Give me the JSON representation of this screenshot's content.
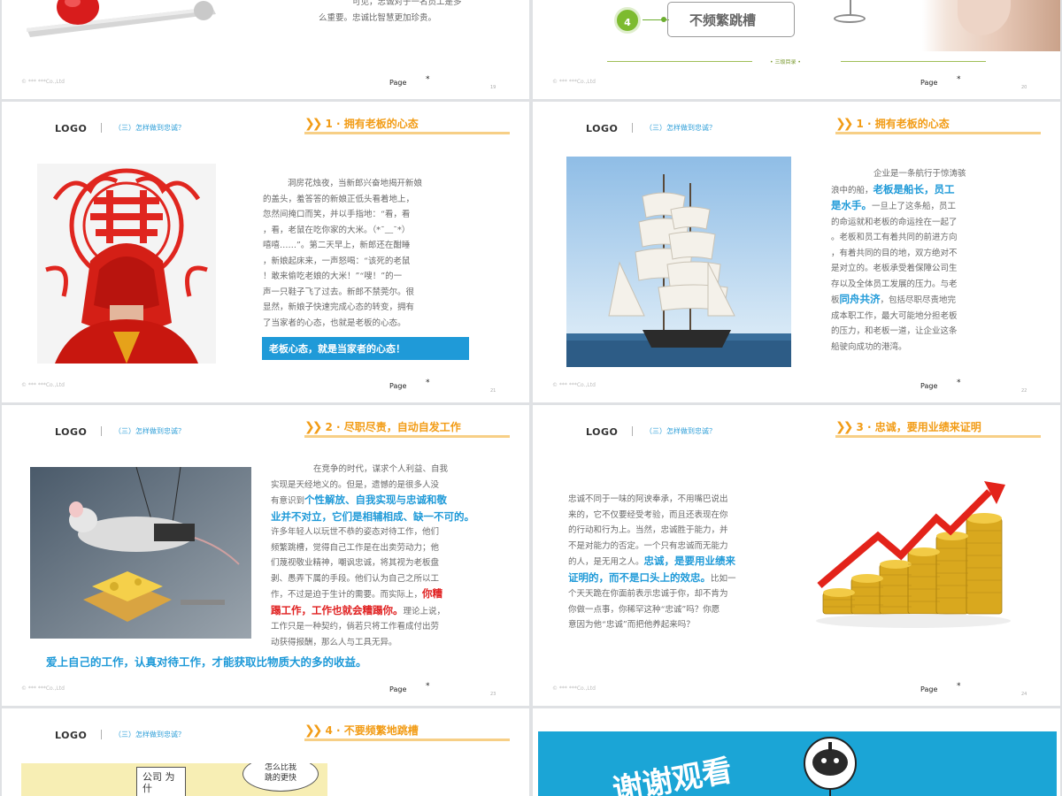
{
  "common": {
    "logo": "LOGO",
    "section": "（三）怎样做到忠诚？",
    "footer_company": "© *** ***Co.,Ltd",
    "footer_page": "Page",
    "footer_star": "*"
  },
  "slide1": {
    "text_line1": "可见，忠诚对于一名员工是多",
    "text_line2": "么重要。忠诚比智慧更加珍贵。",
    "slide_no": "19"
  },
  "slide2": {
    "badge_number": "4",
    "item_label": "不频繁跳槽",
    "bottom_label": "三级目录",
    "slide_no": "20"
  },
  "slide3": {
    "title": "1 · 拥有老板的心态",
    "paragraph": [
      "洞房花烛夜，当新郎兴奋地揭开新娘",
      "的盖头，羞答答的新娘正低头看着地上，",
      "忽然间掩口而笑，并以手指地：“看，看",
      "，看，老鼠在吃你家的大米。（*ˉ﹏ˉ*）",
      "嘻嘻……”。第二天早上，新郎还在酣睡",
      "，新娘起床来，一声怒喝：“该死的老鼠",
      "！敢来偷吃老娘的大米！”“嗖！”的一",
      "声一只鞋子飞了过去。新郎不禁莞尔。很",
      "显然，新娘子快速完成心态的转变，拥有",
      "了当家者的心态，也就是老板的心态。"
    ],
    "callout": "老板心态，就是当家者的心态！",
    "slide_no": "21"
  },
  "slide4": {
    "title": "1 · 拥有老板的心态",
    "p1": "企业是一条航行于惊涛骇",
    "p2": "浪中的船，",
    "hl1": "老板是船长，员工",
    "hl2": "是水手。",
    "p3": "一旦上了这条船，员工",
    "lines": [
      "的命运就和老板的命运拴在一起了",
      "。老板和员工有着共同的前进方向",
      "，有着共同的目的地，双方绝对不",
      "是对立的。老板承受着保障公司生",
      "存以及全体员工发展的压力。与老"
    ],
    "p4": "板",
    "hl3": "同舟共济",
    "p5": "，包括尽职尽责地完",
    "lines2": [
      "成本职工作，最大可能地分担老板",
      "的压力，和老板一道，让企业这条",
      "船驶向成功的港湾。"
    ],
    "slide_no": "22"
  },
  "slide5": {
    "title": "2 · 尽职尽责，自动自发工作",
    "l1": "在竞争的时代，谋求个人利益、自我",
    "l2": "实现是天经地义的。但是，遗憾的是很多人没",
    "l3a": "有意识到",
    "l3b": "个性解放、自我实现与忠诚和敬",
    "l4": "业并不对立，它们是相辅相成、缺一不可的。",
    "lines": [
      "许多年轻人以玩世不恭的姿态对待工作，他们",
      "频繁跳槽，觉得自己工作是在出卖劳动力；他",
      "们蔑视敬业精神，嘲讽忠诚，将其视为老板盘",
      "剥、愚弄下属的手段。他们认为自己之所以工"
    ],
    "l9a": "作，不过是迫于生计的需要。而实际上，",
    "l9b": "你糟",
    "l10a": "蹋工作，工作也就会糟蹋你。",
    "l10b": "理论上说，",
    "l11": "工作只是一种契约，倘若只将工作看成付出劳",
    "l12": "动获得报酬，那么人与工具无异。",
    "bottom": "爱上自己的工作，认真对待工作，才能获取比物质大的多的收益。",
    "slide_no": "23"
  },
  "slide6": {
    "title": "3 · 忠诚，要用业绩来证明",
    "lines": [
      "忠诚不同于一味的阿谀奉承，不用嘴巴说出",
      "来的，它不仅要经受考验，而且还表现在你",
      "的行动和行为上。当然，忠诚胜于能力，并",
      "不是对能力的否定。一个只有忠诚而无能力"
    ],
    "l5a": "的人，是无用之人。",
    "l5b": "忠诚，是要用业绩来",
    "l6a": "证明的，而不是口头上的效忠。",
    "l6b": "比如一",
    "lines2": [
      "个天天跪在你面前表示忠诚于你，却不肯为",
      "你做一点事，你稀罕这种“忠诚”吗？你愿",
      "意因为他“忠诚”而把他养起来吗？"
    ],
    "slide_no": "24"
  },
  "slide7": {
    "title": "4 · 不要频繁地跳槽",
    "bubble1": "怎么比我",
    "bubble2": "跳的更快",
    "sign1": "公司",
    "sign2": "为什"
  },
  "slide8": {
    "thanks": "谢谢观看"
  },
  "colors": {
    "accent_orange": "#f29c16",
    "accent_blue": "#1f9ad8",
    "highlight_red": "#e02020",
    "badge_green": "#7dbb2f"
  }
}
